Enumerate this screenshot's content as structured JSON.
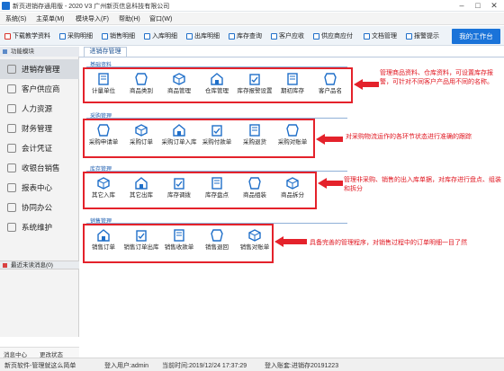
{
  "window": {
    "title": "新页进销存通用版 - 2020 V3 广州新页信息科技有限公司"
  },
  "menu": [
    {
      "label": "系统(S)"
    },
    {
      "label": "主菜单(M)"
    },
    {
      "label": "模块导入(F)"
    },
    {
      "label": "帮助(H)"
    },
    {
      "label": "窗口(W)"
    }
  ],
  "toolbar": {
    "items": [
      {
        "label": "下载教学资料",
        "icon": "download-icon"
      },
      {
        "label": "采购明细",
        "icon": "purchase-detail-icon"
      },
      {
        "label": "销售明细",
        "icon": "sales-detail-icon"
      },
      {
        "label": "入库明细",
        "icon": "stock-in-detail-icon"
      },
      {
        "label": "出库明细",
        "icon": "stock-out-detail-icon"
      },
      {
        "label": "库存查询",
        "icon": "stock-query-icon"
      },
      {
        "label": "客户应收",
        "icon": "receivable-icon"
      },
      {
        "label": "供应商应付",
        "icon": "payable-icon"
      },
      {
        "label": "文档管理",
        "icon": "document-icon"
      },
      {
        "label": "报警提示",
        "icon": "alarm-icon"
      }
    ],
    "workbench": "我的工作台"
  },
  "sidebar": {
    "header": "功能模块",
    "items": [
      {
        "label": "进销存管理"
      },
      {
        "label": "客户供应商"
      },
      {
        "label": "人力资源"
      },
      {
        "label": "财务管理"
      },
      {
        "label": "会计凭证"
      },
      {
        "label": "收银台销售"
      },
      {
        "label": "报表中心"
      },
      {
        "label": "协同办公"
      },
      {
        "label": "系统维护"
      }
    ],
    "recent": "最近未读消息",
    "recent_count": "(0)",
    "footer": [
      "消息中心",
      "更改状态"
    ]
  },
  "main": {
    "tab": "进销存管理",
    "sections": [
      {
        "title": "基础资料",
        "items": [
          "计量单位",
          "商品类别",
          "商品管理",
          "仓库管理",
          "库存报警设置",
          "期初库存",
          "客户品名"
        ],
        "note": "管理商品资料、仓库资料，可设置库存报警，可针对不同客户产品用不同的名称。"
      },
      {
        "title": "采购管理",
        "items": [
          "采购申请单",
          "采购订单",
          "采购订单入库",
          "采购付款单",
          "采购退货",
          "采购对账单"
        ],
        "note": "对采购物流运作的各环节状态进行准确的跟踪"
      },
      {
        "title": "库存管理",
        "items": [
          "其它入库",
          "其它出库",
          "库存调拨",
          "库存盘点",
          "商品组装",
          "商品拆分"
        ],
        "note": "管理非采购、销售的出入库单据，对库存进行盘点、组装和拆分"
      },
      {
        "title": "销售管理",
        "items": [
          "销售订单",
          "销售订单出库",
          "销售收款单",
          "销售退回",
          "销售对账单"
        ],
        "note": "具备完善的管理程序，对销售过程中的订单明细一目了然"
      }
    ]
  },
  "status": {
    "company": "新页软件-管理就这么简单",
    "user": "登入用户:admin",
    "time": "当前时间:2019/12/24 17:37:29",
    "account": "登入账套:进销存20191223"
  },
  "colors": {
    "accent": "#1a73d9",
    "highlight": "#e4222b",
    "icon": "#1f6fc9"
  }
}
